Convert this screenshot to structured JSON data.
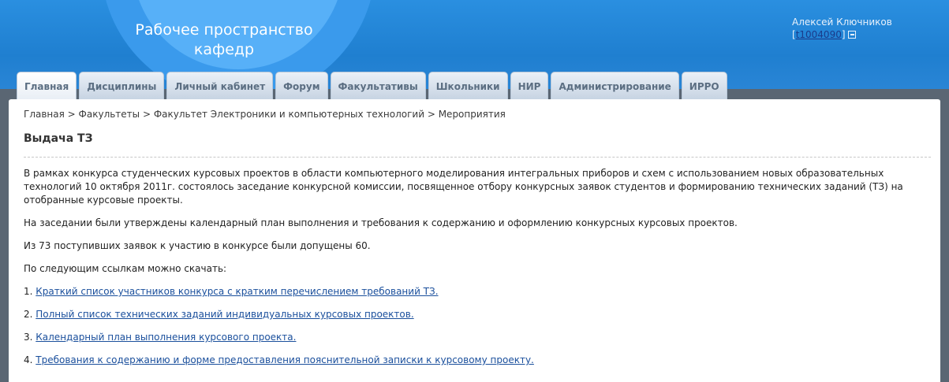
{
  "header": {
    "title_line1": "Рабочее пространство",
    "title_line2": "кафедр",
    "user_name": "Алексей Ключников",
    "user_id": "t1004090",
    "bracket_open": "[",
    "bracket_close": "]",
    "logout_icon": "logout-icon"
  },
  "tabs": [
    {
      "label": "Главная",
      "active": true
    },
    {
      "label": "Дисциплины"
    },
    {
      "label": "Личный кабинет"
    },
    {
      "label": "Форум"
    },
    {
      "label": "Факультативы"
    },
    {
      "label": "Школьники"
    },
    {
      "label": "НИР"
    },
    {
      "label": "Администрирование"
    },
    {
      "label": "ИРРО"
    }
  ],
  "breadcrumb": {
    "items": [
      "Главная",
      "Факультеты",
      "Факультет Электроники и компьютерных технологий",
      "Мероприятия"
    ],
    "separator": " > "
  },
  "page": {
    "title": "Выдача ТЗ",
    "paragraphs": [
      "В рамках конкурса студенческих курсовых проектов в области компьютерного моделирования интегральных приборов и схем с использованием новых образовательных технологий 10 октября 2011г. состоялось заседание конкурсной комиссии, посвященное отбору конкурсных заявок студентов и формированию технических заданий (ТЗ) на отобранные курсовые проекты.",
      "На заседании были утверждены календарный план выполнения и требования к содержанию и оформлению конкурсных курсовых проектов.",
      "Из 73 поступивших заявок к участию в конкурсе были допущены 60.",
      "По следующим ссылкам можно скачать:"
    ],
    "links": [
      {
        "num": "1. ",
        "text": "Краткий список участников конкурса с кратким перечислением требований ТЗ."
      },
      {
        "num": "2. ",
        "text": "Полный список технических заданий индивидуальных курсовых проектов."
      },
      {
        "num": "3. ",
        "text": "Календарный план выполнения курсового проекта."
      },
      {
        "num": "4. ",
        "text": "Требования к содержанию и форме предоставления пояснительной записки к курсовому проекту."
      }
    ]
  }
}
